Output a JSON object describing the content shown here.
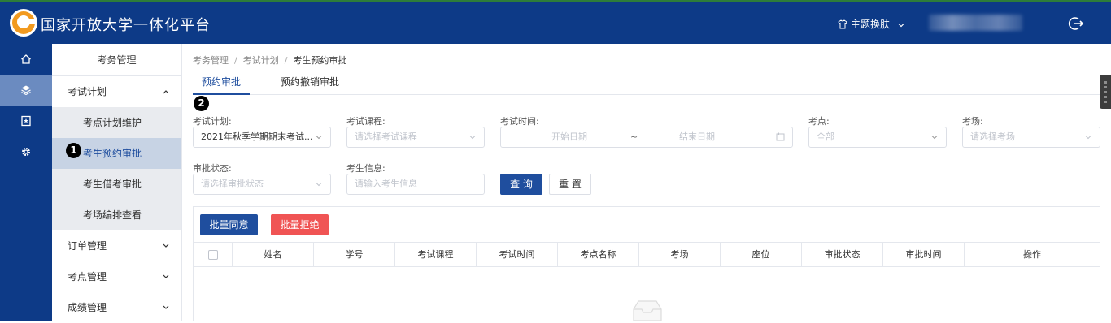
{
  "header": {
    "app_title": "国家开放大学一体化平台",
    "theme_label": "主题换肤",
    "logo_icon": "ouchn-logo",
    "user_name_blurred": ""
  },
  "rail": {
    "items": [
      {
        "icon": "home-icon",
        "active": false
      },
      {
        "icon": "layers-icon",
        "active": true
      },
      {
        "icon": "bookmark-star-icon",
        "active": false
      },
      {
        "icon": "gear-icon",
        "active": false
      }
    ]
  },
  "submenu": {
    "title": "考务管理",
    "groups": [
      {
        "label": "考试计划",
        "expanded": true,
        "items": [
          "考点计划维护",
          "考生预约审批",
          "考生借考审批",
          "考场编排查看"
        ],
        "active_item": "考生预约审批"
      },
      {
        "label": "订单管理",
        "expanded": false
      },
      {
        "label": "考点管理",
        "expanded": false
      },
      {
        "label": "成绩管理",
        "expanded": false
      }
    ]
  },
  "badges": {
    "one": "1",
    "two": "2"
  },
  "breadcrumb": [
    "考务管理",
    "考试计划",
    "考生预约审批"
  ],
  "breadcrumb_sep": "/",
  "tabs": [
    "预约审批",
    "预约撤销审批"
  ],
  "filters": {
    "plan": {
      "label": "考试计划:",
      "value": "2021年秋季学期期末考试..."
    },
    "course": {
      "label": "考试课程:",
      "placeholder": "请选择考试课程"
    },
    "time": {
      "label": "考试时间:",
      "start": "开始日期",
      "sep": "~",
      "end": "结束日期"
    },
    "site": {
      "label": "考点:",
      "value": "全部"
    },
    "room": {
      "label": "考场:",
      "placeholder": "请选择考场"
    },
    "status": {
      "label": "审批状态:",
      "placeholder": "请选择审批状态"
    },
    "student": {
      "label": "考生信息:",
      "placeholder": "请输入考生信息"
    }
  },
  "buttons": {
    "query": "查 询",
    "reset": "重 置",
    "batch_approve": "批量同意",
    "batch_reject": "批量拒绝"
  },
  "table": {
    "columns": [
      "姓名",
      "学号",
      "考试课程",
      "考试时间",
      "考点名称",
      "考场",
      "座位",
      "审批状态",
      "审批时间",
      "操作"
    ],
    "rows": []
  },
  "colors": {
    "header_bg": "#0d3a87",
    "primary": "#1f4e9e",
    "danger": "#f05454",
    "active_sub": "#c7d3e4"
  }
}
